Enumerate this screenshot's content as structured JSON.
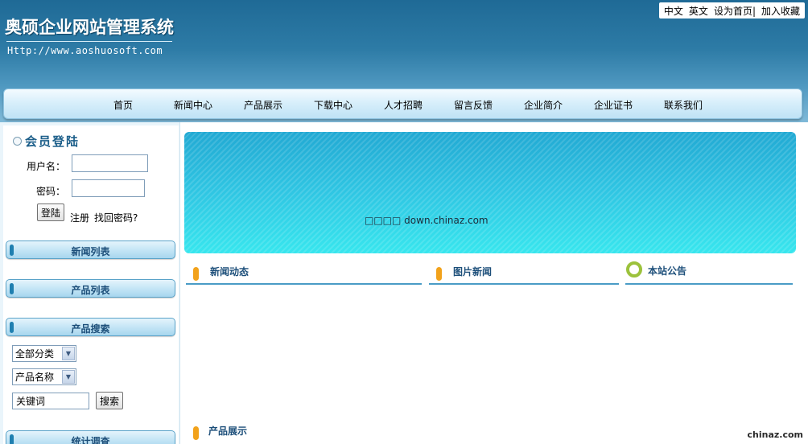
{
  "header": {
    "site_title": "奥硕企业网站管理系统",
    "site_url": "Http://www.aoshuosoft.com",
    "top_links": [
      "中文",
      "英文",
      "设为首页|",
      "加入收藏"
    ]
  },
  "nav": {
    "items": [
      "首页",
      "新闻中心",
      "产品展示",
      "下载中心",
      "人才招聘",
      "留言反馈",
      "企业简介",
      "企业证书",
      "联系我们"
    ]
  },
  "login": {
    "title": "会员登陆",
    "username_label": "用户名：",
    "password_label": "密码：",
    "username_value": "",
    "password_value": "",
    "login_button": "登陆",
    "register_link": "注册",
    "forgot_link": "找回密码?"
  },
  "sidebar": {
    "news_list": "新闻列表",
    "product_list": "产品列表",
    "product_search": "产品搜索",
    "statistics": "统计调查"
  },
  "search": {
    "category_select": "全部分类",
    "field_select": "产品名称",
    "keyword_value": "关键词",
    "search_button": "搜索"
  },
  "main": {
    "banner_text": "□□□□ down.chinaz.com",
    "sections": {
      "news_dynamic": "新闻动态",
      "picture_news": "图片新闻",
      "site_notice": "本站公告",
      "product_showcase": "产品展示"
    }
  },
  "watermark": "chinaz.com",
  "colors": {
    "header_blue": "#2d7ba6",
    "title_blue": "#1d4f7a",
    "bullet_orange": "#f2a21b",
    "ring_green": "#9cc23c",
    "banner_cyan": "#2fc6e3"
  }
}
